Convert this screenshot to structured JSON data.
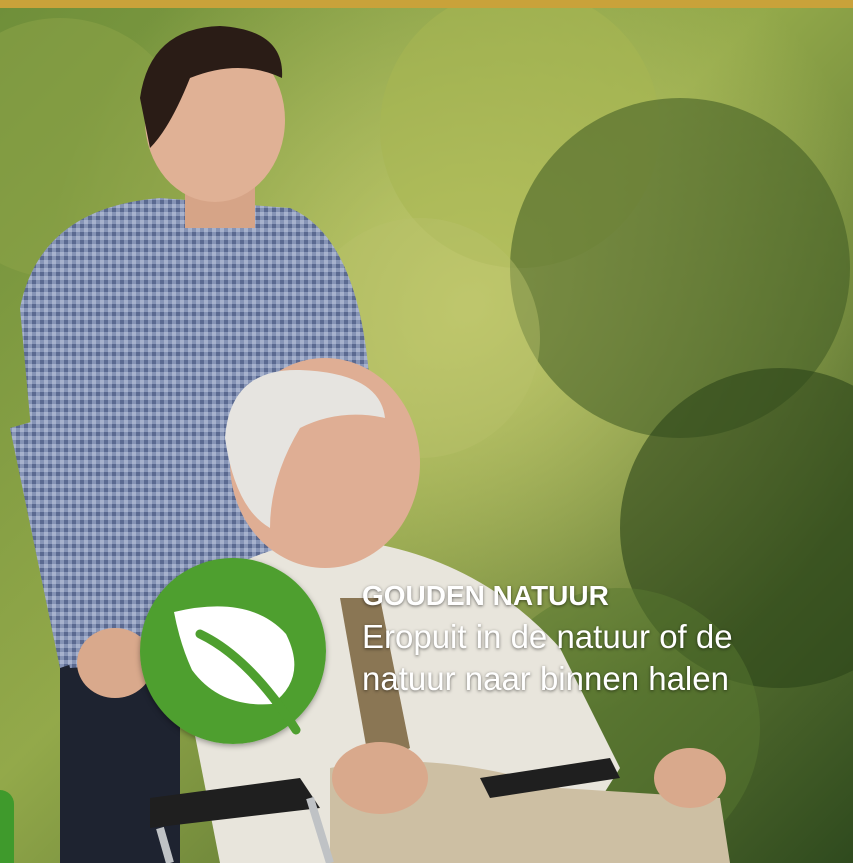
{
  "colors": {
    "gold_bar": "#c9a23a",
    "badge_green": "#4e9f2f",
    "leaf_white": "#ffffff",
    "edge_green": "#3f9a2c"
  },
  "feature": {
    "icon": "leaf-icon",
    "title": "GOUDEN NATUUR",
    "line1": "Eropuit in de natuur of de",
    "line2": "natuur naar binnen halen"
  }
}
